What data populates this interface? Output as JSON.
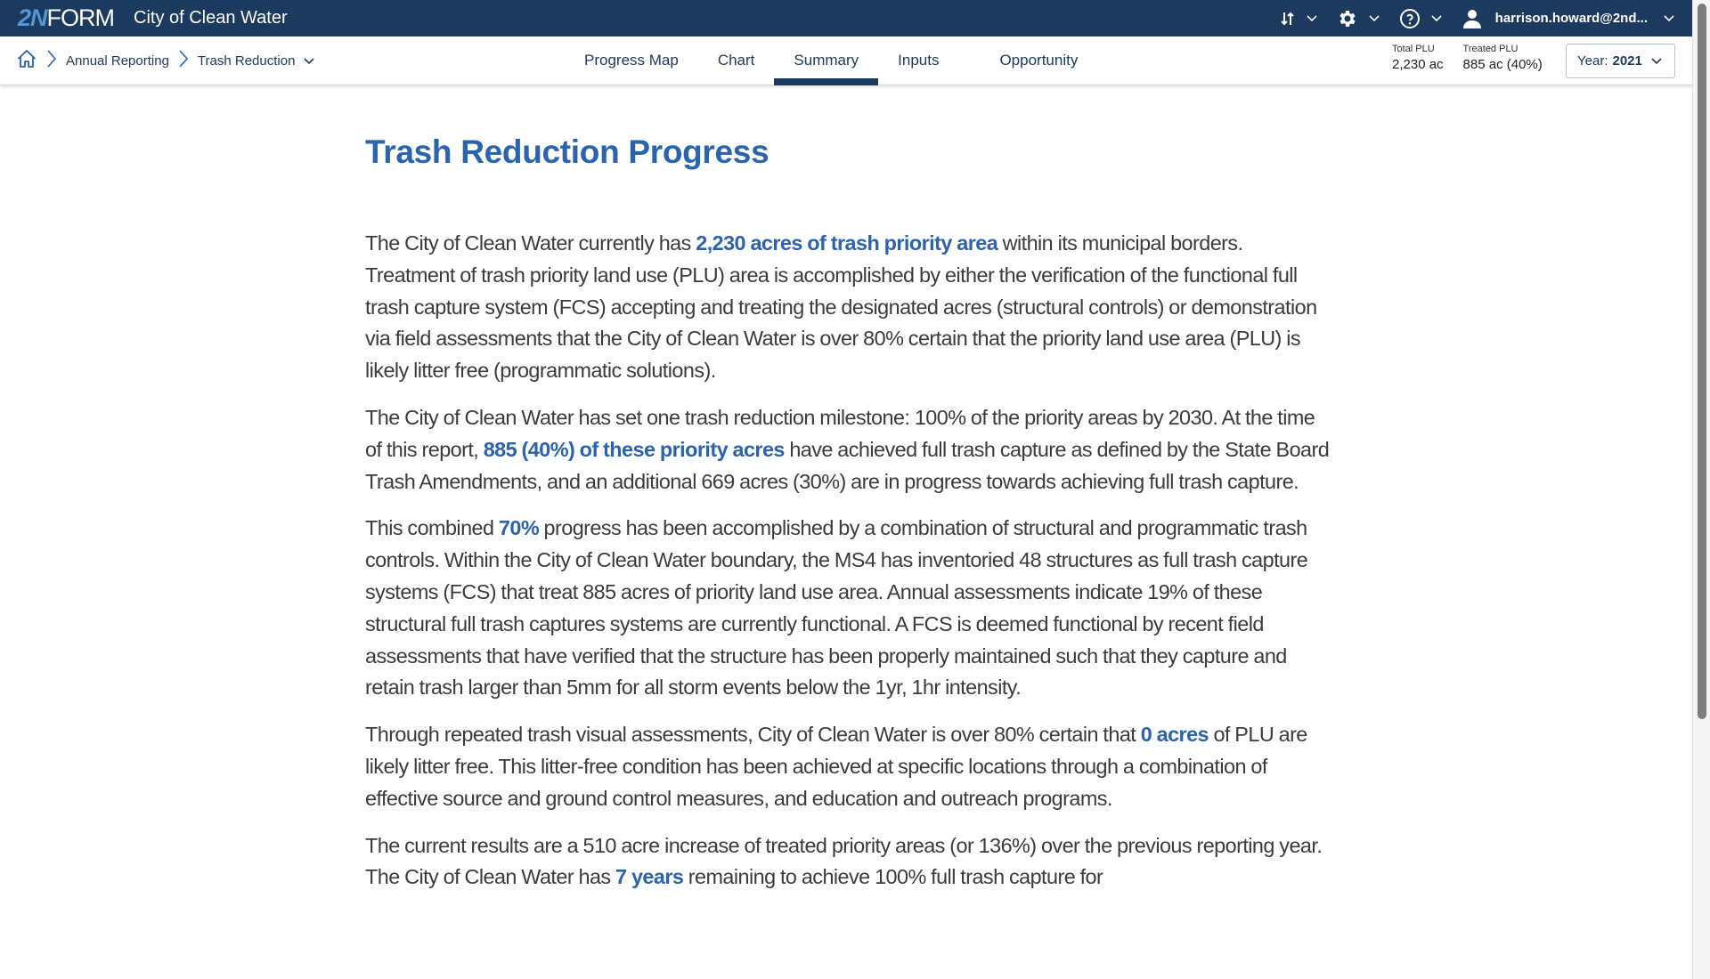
{
  "app": {
    "logo_mark": "2N",
    "logo_text": "FORM",
    "title": "City of Clean Water",
    "brand_color": "#1c3a5e",
    "accent_color": "#2a63ae"
  },
  "topbar": {
    "sort_icon": "sort-arrows-icon",
    "settings_icon": "gear-icon",
    "help_icon": "help-circle-icon",
    "user_icon": "user-icon",
    "user_name": "harrison.howard@2nd..."
  },
  "breadcrumb": {
    "home_icon": "home-icon",
    "items": [
      "Annual Reporting",
      "Trash Reduction"
    ]
  },
  "tabs": [
    {
      "label": "Progress Map",
      "active": false
    },
    {
      "label": "Chart",
      "active": false
    },
    {
      "label": "Summary",
      "active": true
    },
    {
      "label": "Inputs",
      "active": false
    },
    {
      "label": "Opportunity",
      "active": false
    }
  ],
  "stats": {
    "total_plu_label": "Total PLU",
    "total_plu_value": "2,230 ac",
    "treated_plu_label": "Treated PLU",
    "treated_plu_value": "885 ac (40%)"
  },
  "year_select": {
    "label": "Year:",
    "value": "2021"
  },
  "main": {
    "title": "Trash Reduction Progress",
    "paragraphs": [
      {
        "segments": [
          {
            "text": "The City of Clean Water currently has ",
            "hl": false
          },
          {
            "text": "2,230 acres of trash priority area",
            "hl": true
          },
          {
            "text": " within its municipal borders. Treatment of trash priority land use (PLU) area is accomplished by either the verification of the functional full trash capture system (FCS) accepting and treating the designated acres (structural controls) or demonstration via field assessments that the City of Clean Water is over 80% certain that the priority land use area (PLU) is likely litter free (programmatic solutions).",
            "hl": false
          }
        ]
      },
      {
        "segments": [
          {
            "text": "The City of Clean Water has set one trash reduction milestone: 100% of the priority areas by 2030. At the time of this report, ",
            "hl": false
          },
          {
            "text": "885 (40%) of these priority acres",
            "hl": true
          },
          {
            "text": " have achieved full trash capture as defined by the State Board Trash Amendments, and an additional 669 acres (30%) are in progress towards achieving full trash capture.",
            "hl": false
          }
        ]
      },
      {
        "segments": [
          {
            "text": "This combined ",
            "hl": false
          },
          {
            "text": "70%",
            "hl": true
          },
          {
            "text": " progress has been accomplished by a combination of structural and programmatic trash controls. Within the City of Clean Water boundary, the MS4 has inventoried 48 structures as full trash capture systems (FCS) that treat 885 acres of priority land use area. Annual assessments indicate 19% of these structural full trash captures systems are currently functional. A FCS is deemed functional by recent field assessments that have verified that the structure has been properly maintained such that they capture and retain trash larger than 5mm for all storm events below the 1yr, 1hr intensity.",
            "hl": false
          }
        ]
      },
      {
        "segments": [
          {
            "text": "Through repeated trash visual assessments, City of Clean Water is over 80% certain that ",
            "hl": false
          },
          {
            "text": "0 acres",
            "hl": true
          },
          {
            "text": " of PLU are likely litter free. This litter-free condition has been achieved at specific locations through a combination of effective source and ground control measures, and education and outreach programs.",
            "hl": false
          }
        ]
      },
      {
        "segments": [
          {
            "text": "The current results are a 510 acre increase of treated priority areas (or 136%) over the previous reporting year. The City of Clean Water has ",
            "hl": false
          },
          {
            "text": "7 years",
            "hl": true
          },
          {
            "text": " remaining to achieve 100% full trash capture for",
            "hl": false
          }
        ]
      }
    ]
  }
}
